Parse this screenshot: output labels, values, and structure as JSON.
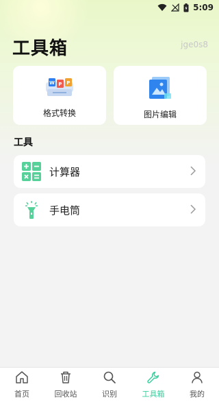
{
  "status_bar": {
    "time": "5:09"
  },
  "header": {
    "title": "工具箱",
    "user_id": "jge0s8"
  },
  "cards": [
    {
      "label": "格式转换",
      "icon": "format-convert-icon"
    },
    {
      "label": "图片编辑",
      "icon": "image-edit-icon"
    }
  ],
  "section": {
    "title": "工具"
  },
  "tools": [
    {
      "label": "计算器",
      "icon": "calculator-icon"
    },
    {
      "label": "手电筒",
      "icon": "flashlight-icon"
    }
  ],
  "bottom_nav": [
    {
      "label": "首页",
      "icon": "home-icon"
    },
    {
      "label": "回收站",
      "icon": "trash-icon"
    },
    {
      "label": "识别",
      "icon": "search-icon"
    },
    {
      "label": "工具箱",
      "icon": "wrench-icon",
      "active": true
    },
    {
      "label": "我的",
      "icon": "user-icon"
    }
  ],
  "colors": {
    "accent": "#3ccf9f",
    "icon_green": "#57d19a"
  }
}
